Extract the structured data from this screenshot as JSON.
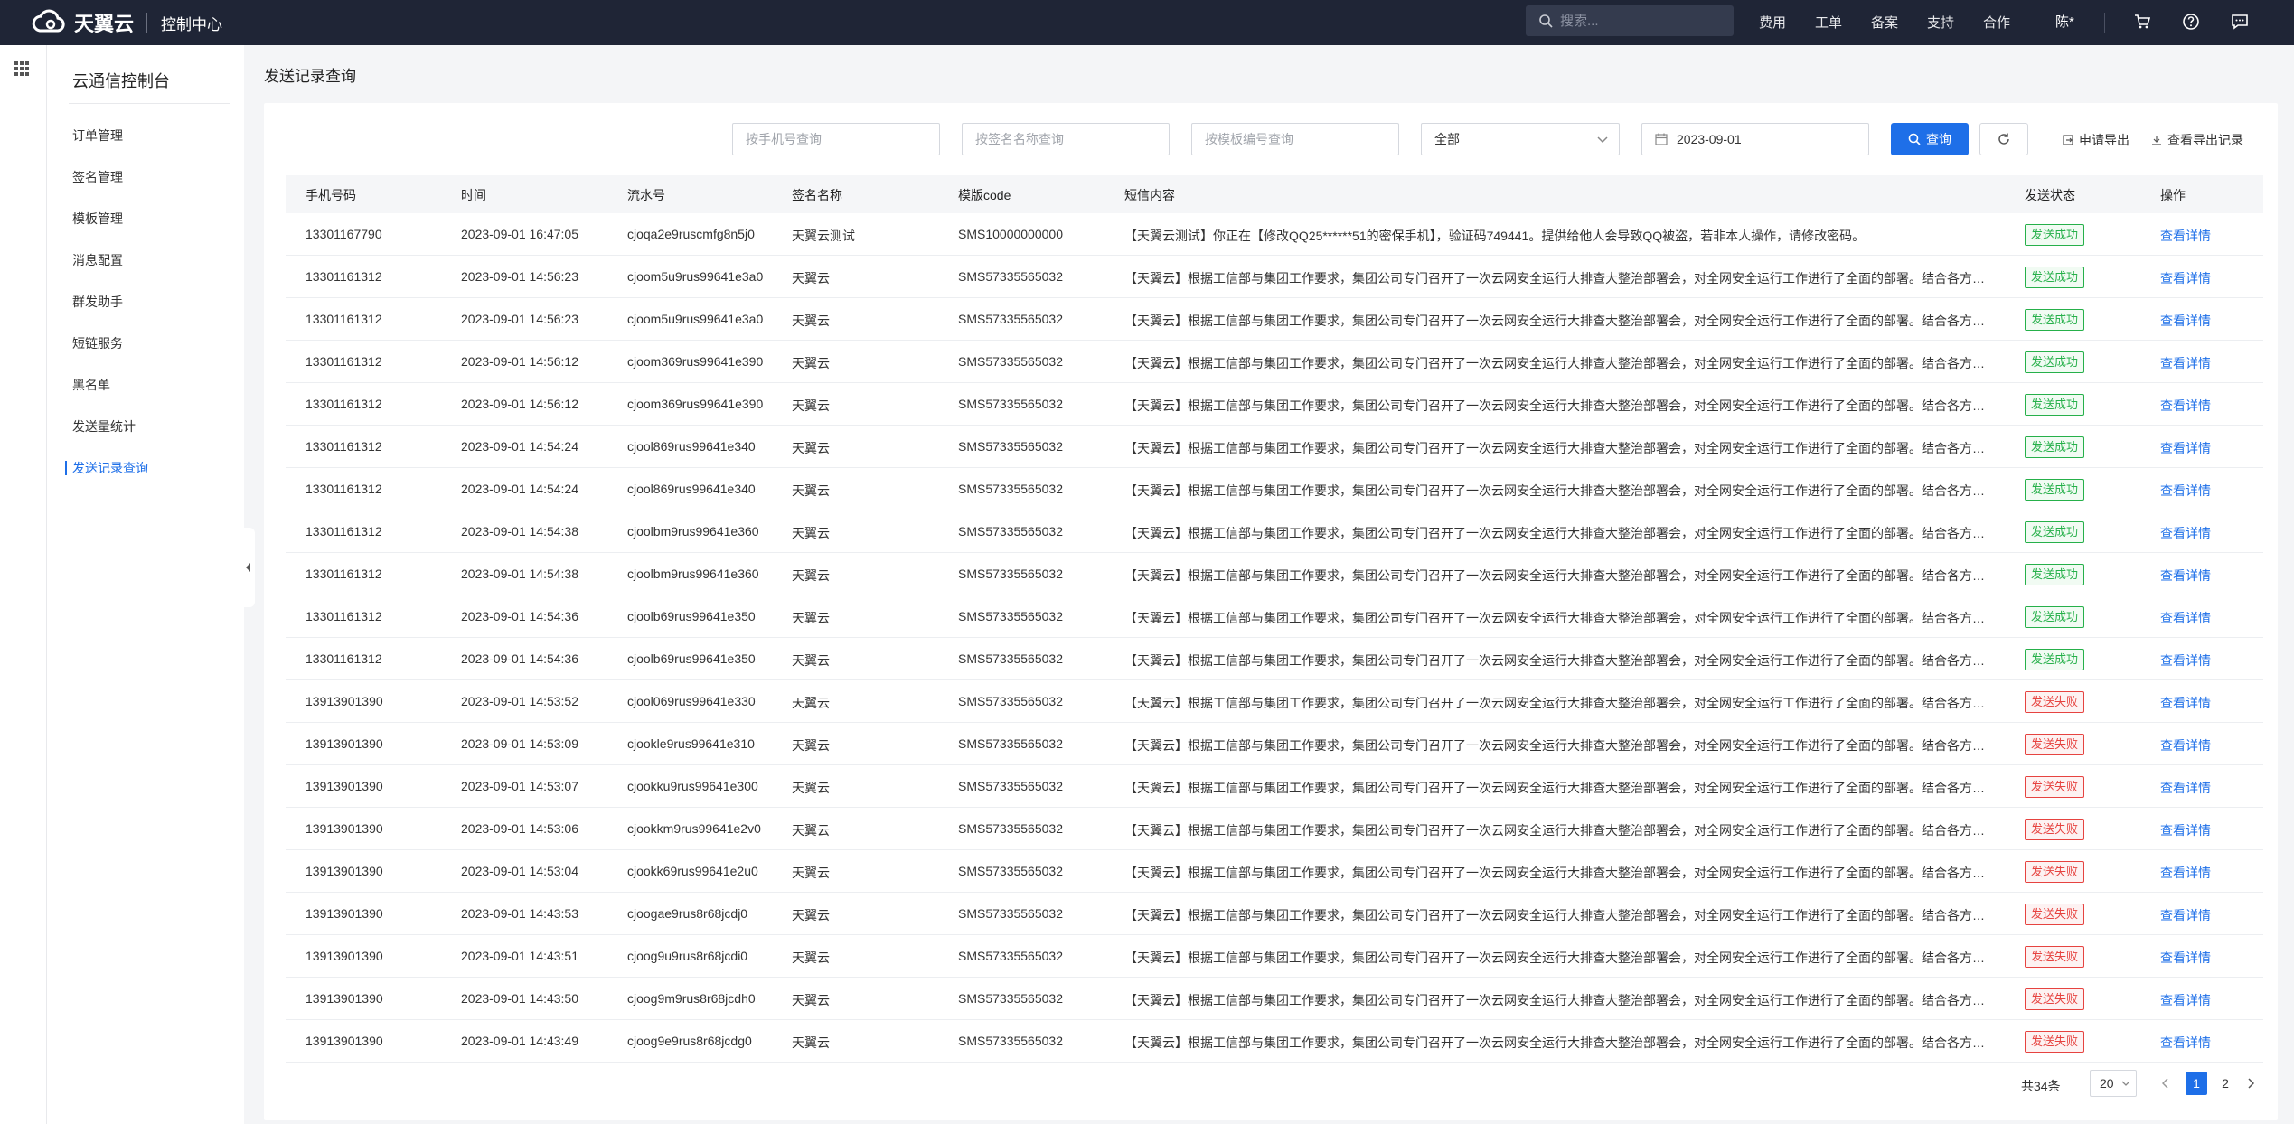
{
  "topbar": {
    "brand": "天翼云",
    "console_title": "控制中心",
    "search_placeholder": "搜索...",
    "nav": [
      "费用",
      "工单",
      "备案",
      "支持",
      "合作"
    ],
    "user": "陈*"
  },
  "sidebar": {
    "title": "云通信控制台",
    "items": [
      {
        "label": "订单管理",
        "active": false
      },
      {
        "label": "签名管理",
        "active": false
      },
      {
        "label": "模板管理",
        "active": false
      },
      {
        "label": "消息配置",
        "active": false
      },
      {
        "label": "群发助手",
        "active": false
      },
      {
        "label": "短链服务",
        "active": false
      },
      {
        "label": "黑名单",
        "active": false
      },
      {
        "label": "发送量统计",
        "active": false
      },
      {
        "label": "发送记录查询",
        "active": true
      }
    ]
  },
  "main": {
    "page_title": "发送记录查询",
    "filters": {
      "phone_placeholder": "按手机号查询",
      "sign_placeholder": "按签名名称查询",
      "template_placeholder": "按模板编号查询",
      "status_value": "全部",
      "date_value": "2023-09-01"
    },
    "query_label": "查询",
    "export_label": "申请导出",
    "view_export_label": "查看导出记录",
    "columns": [
      "手机号码",
      "时间",
      "流水号",
      "签名名称",
      "模版code",
      "短信内容",
      "发送状态",
      "操作"
    ],
    "detail_label": "查看详情",
    "rows": [
      {
        "phone": "13301167790",
        "time": "2023-09-01 16:47:05",
        "serial": "cjoqa2e9ruscmfg8n5j0",
        "sign": "天翼云测试",
        "code": "SMS10000000000",
        "content": "【天翼云测试】你正在【修改QQ25******51的密保手机】，验证码749441。提供给他人会导致QQ被盗，若非本人操作，请修改密码。",
        "status": "发送成功",
        "ok": true
      },
      {
        "phone": "13301161312",
        "time": "2023-09-01 14:56:23",
        "serial": "cjoom5u9rus99641e3a0",
        "sign": "天翼云",
        "code": "SMS57335565032",
        "content": "【天翼云】根据工信部与集团工作要求，集团公司专门召开了一次云网安全运行大排查大整治部署会，对全网安全运行工作进行了全面的部署。结合各方要求...",
        "status": "发送成功",
        "ok": true
      },
      {
        "phone": "13301161312",
        "time": "2023-09-01 14:56:23",
        "serial": "cjoom5u9rus99641e3a0",
        "sign": "天翼云",
        "code": "SMS57335565032",
        "content": "【天翼云】根据工信部与集团工作要求，集团公司专门召开了一次云网安全运行大排查大整治部署会，对全网安全运行工作进行了全面的部署。结合各方要求...",
        "status": "发送成功",
        "ok": true
      },
      {
        "phone": "13301161312",
        "time": "2023-09-01 14:56:12",
        "serial": "cjoom369rus99641e390",
        "sign": "天翼云",
        "code": "SMS57335565032",
        "content": "【天翼云】根据工信部与集团工作要求，集团公司专门召开了一次云网安全运行大排查大整治部署会，对全网安全运行工作进行了全面的部署。结合各方要求...",
        "status": "发送成功",
        "ok": true
      },
      {
        "phone": "13301161312",
        "time": "2023-09-01 14:56:12",
        "serial": "cjoom369rus99641e390",
        "sign": "天翼云",
        "code": "SMS57335565032",
        "content": "【天翼云】根据工信部与集团工作要求，集团公司专门召开了一次云网安全运行大排查大整治部署会，对全网安全运行工作进行了全面的部署。结合各方要求...",
        "status": "发送成功",
        "ok": true
      },
      {
        "phone": "13301161312",
        "time": "2023-09-01 14:54:24",
        "serial": "cjool869rus99641e340",
        "sign": "天翼云",
        "code": "SMS57335565032",
        "content": "【天翼云】根据工信部与集团工作要求，集团公司专门召开了一次云网安全运行大排查大整治部署会，对全网安全运行工作进行了全面的部署。结合各方要求...",
        "status": "发送成功",
        "ok": true
      },
      {
        "phone": "13301161312",
        "time": "2023-09-01 14:54:24",
        "serial": "cjool869rus99641e340",
        "sign": "天翼云",
        "code": "SMS57335565032",
        "content": "【天翼云】根据工信部与集团工作要求，集团公司专门召开了一次云网安全运行大排查大整治部署会，对全网安全运行工作进行了全面的部署。结合各方要求...",
        "status": "发送成功",
        "ok": true
      },
      {
        "phone": "13301161312",
        "time": "2023-09-01 14:54:38",
        "serial": "cjoolbm9rus99641e360",
        "sign": "天翼云",
        "code": "SMS57335565032",
        "content": "【天翼云】根据工信部与集团工作要求，集团公司专门召开了一次云网安全运行大排查大整治部署会，对全网安全运行工作进行了全面的部署。结合各方要求...",
        "status": "发送成功",
        "ok": true
      },
      {
        "phone": "13301161312",
        "time": "2023-09-01 14:54:38",
        "serial": "cjoolbm9rus99641e360",
        "sign": "天翼云",
        "code": "SMS57335565032",
        "content": "【天翼云】根据工信部与集团工作要求，集团公司专门召开了一次云网安全运行大排查大整治部署会，对全网安全运行工作进行了全面的部署。结合各方要求...",
        "status": "发送成功",
        "ok": true
      },
      {
        "phone": "13301161312",
        "time": "2023-09-01 14:54:36",
        "serial": "cjoolb69rus99641e350",
        "sign": "天翼云",
        "code": "SMS57335565032",
        "content": "【天翼云】根据工信部与集团工作要求，集团公司专门召开了一次云网安全运行大排查大整治部署会，对全网安全运行工作进行了全面的部署。结合各方要求...",
        "status": "发送成功",
        "ok": true
      },
      {
        "phone": "13301161312",
        "time": "2023-09-01 14:54:36",
        "serial": "cjoolb69rus99641e350",
        "sign": "天翼云",
        "code": "SMS57335565032",
        "content": "【天翼云】根据工信部与集团工作要求，集团公司专门召开了一次云网安全运行大排查大整治部署会，对全网安全运行工作进行了全面的部署。结合各方要求...",
        "status": "发送成功",
        "ok": true
      },
      {
        "phone": "13913901390",
        "time": "2023-09-01 14:53:52",
        "serial": "cjool069rus99641e330",
        "sign": "天翼云",
        "code": "SMS57335565032",
        "content": "【天翼云】根据工信部与集团工作要求，集团公司专门召开了一次云网安全运行大排查大整治部署会，对全网安全运行工作进行了全面的部署。结合各方要求...",
        "status": "发送失败",
        "ok": false
      },
      {
        "phone": "13913901390",
        "time": "2023-09-01 14:53:09",
        "serial": "cjookle9rus99641e310",
        "sign": "天翼云",
        "code": "SMS57335565032",
        "content": "【天翼云】根据工信部与集团工作要求，集团公司专门召开了一次云网安全运行大排查大整治部署会，对全网安全运行工作进行了全面的部署。结合各方要求...",
        "status": "发送失败",
        "ok": false
      },
      {
        "phone": "13913901390",
        "time": "2023-09-01 14:53:07",
        "serial": "cjookku9rus99641e300",
        "sign": "天翼云",
        "code": "SMS57335565032",
        "content": "【天翼云】根据工信部与集团工作要求，集团公司专门召开了一次云网安全运行大排查大整治部署会，对全网安全运行工作进行了全面的部署。结合各方要求...",
        "status": "发送失败",
        "ok": false
      },
      {
        "phone": "13913901390",
        "time": "2023-09-01 14:53:06",
        "serial": "cjookkm9rus99641e2v0",
        "sign": "天翼云",
        "code": "SMS57335565032",
        "content": "【天翼云】根据工信部与集团工作要求，集团公司专门召开了一次云网安全运行大排查大整治部署会，对全网安全运行工作进行了全面的部署。结合各方要求...",
        "status": "发送失败",
        "ok": false
      },
      {
        "phone": "13913901390",
        "time": "2023-09-01 14:53:04",
        "serial": "cjookk69rus99641e2u0",
        "sign": "天翼云",
        "code": "SMS57335565032",
        "content": "【天翼云】根据工信部与集团工作要求，集团公司专门召开了一次云网安全运行大排查大整治部署会，对全网安全运行工作进行了全面的部署。结合各方要求...",
        "status": "发送失败",
        "ok": false
      },
      {
        "phone": "13913901390",
        "time": "2023-09-01 14:43:53",
        "serial": "cjoogae9rus8r68jcdj0",
        "sign": "天翼云",
        "code": "SMS57335565032",
        "content": "【天翼云】根据工信部与集团工作要求，集团公司专门召开了一次云网安全运行大排查大整治部署会，对全网安全运行工作进行了全面的部署。结合各方要求...",
        "status": "发送失败",
        "ok": false
      },
      {
        "phone": "13913901390",
        "time": "2023-09-01 14:43:51",
        "serial": "cjoog9u9rus8r68jcdi0",
        "sign": "天翼云",
        "code": "SMS57335565032",
        "content": "【天翼云】根据工信部与集团工作要求，集团公司专门召开了一次云网安全运行大排查大整治部署会，对全网安全运行工作进行了全面的部署。结合各方要求...",
        "status": "发送失败",
        "ok": false
      },
      {
        "phone": "13913901390",
        "time": "2023-09-01 14:43:50",
        "serial": "cjoog9m9rus8r68jcdh0",
        "sign": "天翼云",
        "code": "SMS57335565032",
        "content": "【天翼云】根据工信部与集团工作要求，集团公司专门召开了一次云网安全运行大排查大整治部署会，对全网安全运行工作进行了全面的部署。结合各方要求...",
        "status": "发送失败",
        "ok": false
      },
      {
        "phone": "13913901390",
        "time": "2023-09-01 14:43:49",
        "serial": "cjoog9e9rus8r68jcdg0",
        "sign": "天翼云",
        "code": "SMS57335565032",
        "content": "【天翼云】根据工信部与集团工作要求，集团公司专门召开了一次云网安全运行大排查大整治部署会，对全网安全运行工作进行了全面的部署。结合各方要求...",
        "status": "发送失败",
        "ok": false
      }
    ],
    "pagination": {
      "total": "共34条",
      "page_size": "20",
      "pages": [
        "1",
        "2"
      ],
      "current": "1"
    }
  },
  "colors": {
    "primary": "#1e6fe8",
    "topbar_bg": "#1f2536",
    "success": "#26b04a",
    "fail": "#e64340"
  }
}
